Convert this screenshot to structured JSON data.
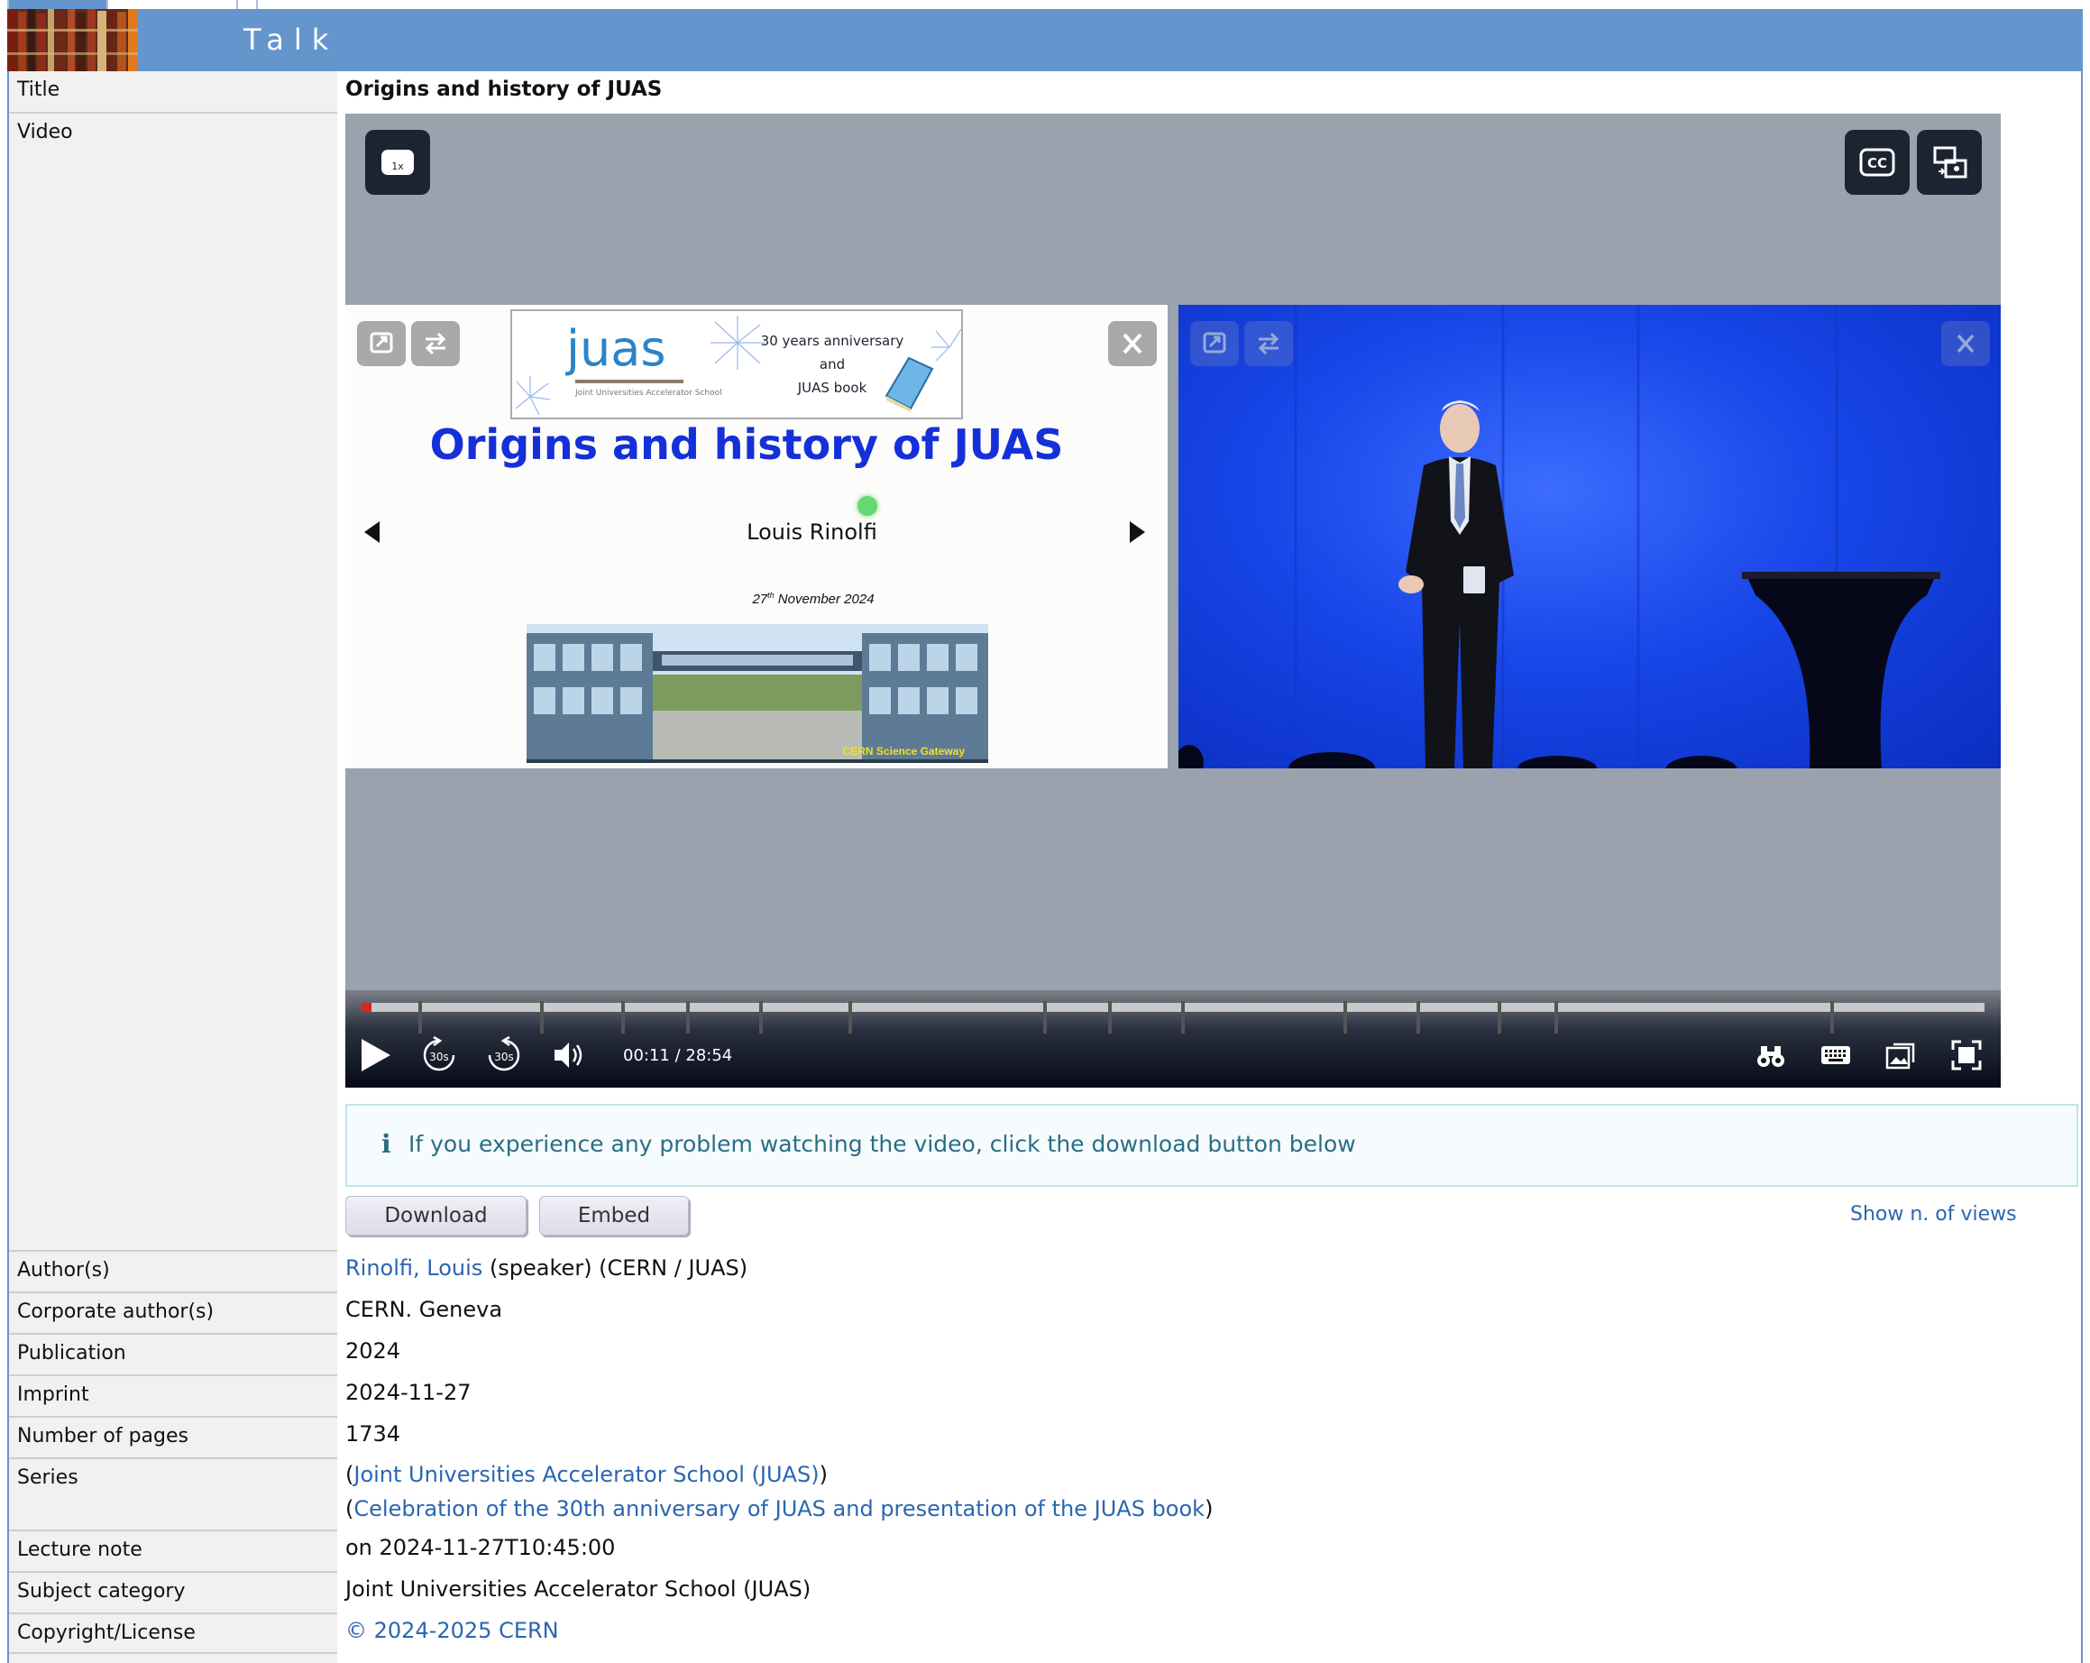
{
  "header": {
    "title": "Talk"
  },
  "rows": {
    "title_label": "Title",
    "title_value": "Origins and history of JUAS",
    "video_label": "Video",
    "authors_label": "Author(s)",
    "author_link": "Rinolfi, Louis",
    "author_rest": "(speaker) (CERN / JUAS)",
    "corporate_label": "Corporate author(s)",
    "corporate_value": "CERN. Geneva",
    "publication_label": "Publication",
    "publication_value": "2024",
    "imprint_label": "Imprint",
    "imprint_value": "2024-11-27",
    "pages_label": "Number of pages",
    "pages_value": "1734",
    "series_label": "Series",
    "series_1": "Joint Universities Accelerator School (JUAS)",
    "series_2": "Celebration of the 30th anniversary of JUAS and presentation of the JUAS book",
    "open_paren": "(",
    "close_paren": ")",
    "lecture_label": "Lecture note",
    "lecture_value": "on 2024-11-27T10:45:00",
    "subject_label": "Subject category",
    "subject_value": "Joint Universities Accelerator School (JUAS)",
    "copyright_label": "Copyright/License",
    "copyright_value": "© 2024-2025 CERN"
  },
  "player": {
    "speed_label": "1x",
    "cc_label": "CC",
    "time": "00:11 / 28:54",
    "progress_fraction": 0.006,
    "skip_back_label": "30s",
    "skip_forward_label": "30s",
    "chapter_fractions": [
      0.035,
      0.11,
      0.16,
      0.2,
      0.245,
      0.3,
      0.42,
      0.46,
      0.505,
      0.605,
      0.65,
      0.7,
      0.735,
      0.905
    ]
  },
  "slide": {
    "juas_logo": "juas",
    "juas_subtitle": "Joint Universities Accelerator School",
    "anniv_1": "30 years anniversary",
    "anniv_2": "and",
    "anniv_3": "JUAS book",
    "title": "Origins and history of JUAS",
    "speaker": "Louis Rinolfi",
    "date_day": "27",
    "date_sup": "th",
    "date_rest": " November 2024",
    "photo_caption": "CERN Science Gateway"
  },
  "notice": {
    "text": "If you experience any problem watching the video, click the download button below"
  },
  "actions": {
    "download": "Download",
    "embed": "Embed",
    "show_views": "Show n. of views"
  },
  "colors": {
    "header": "#6496cd",
    "link": "#2a66b0",
    "notice_text": "#2b6d86",
    "slide_title": "#1530d8"
  }
}
